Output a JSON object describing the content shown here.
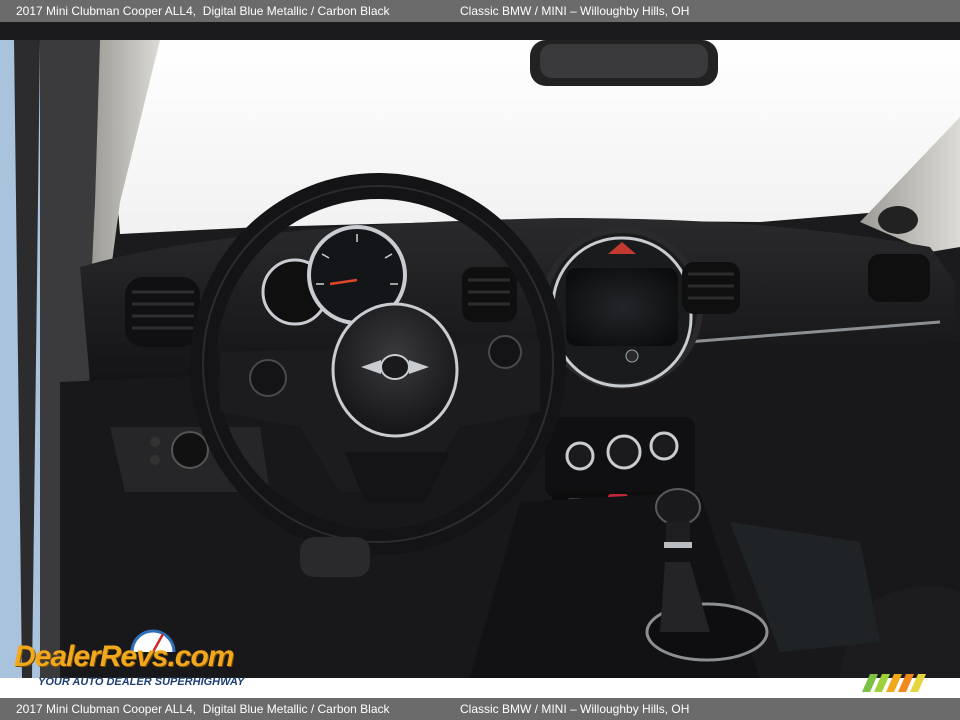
{
  "header": {
    "vehicle": "2017 Mini Clubman Cooper ALL4,  Digital Blue Metallic / Carbon Black",
    "dealer": "Classic BMW / MINI – Willoughby Hills, OH"
  },
  "footer": {
    "vehicle": "2017 Mini Clubman Cooper ALL4,  Digital Blue Metallic / Carbon Black",
    "dealer": "Classic BMW / MINI – Willoughby Hills, OH"
  },
  "watermark": {
    "logo_text": "DealerRevs.com",
    "tagline": "YOUR AUTO DEALER SUPERHIGHWAY"
  },
  "colors": {
    "bar_gray": "#6b6b6b",
    "logo_orange": "#f2a81d",
    "logo_blue": "#2f6fb7",
    "car_exterior_blue": "#a9c3dc",
    "dashboard_black": "#1f1f21",
    "chrome": "#c9ccd1"
  }
}
